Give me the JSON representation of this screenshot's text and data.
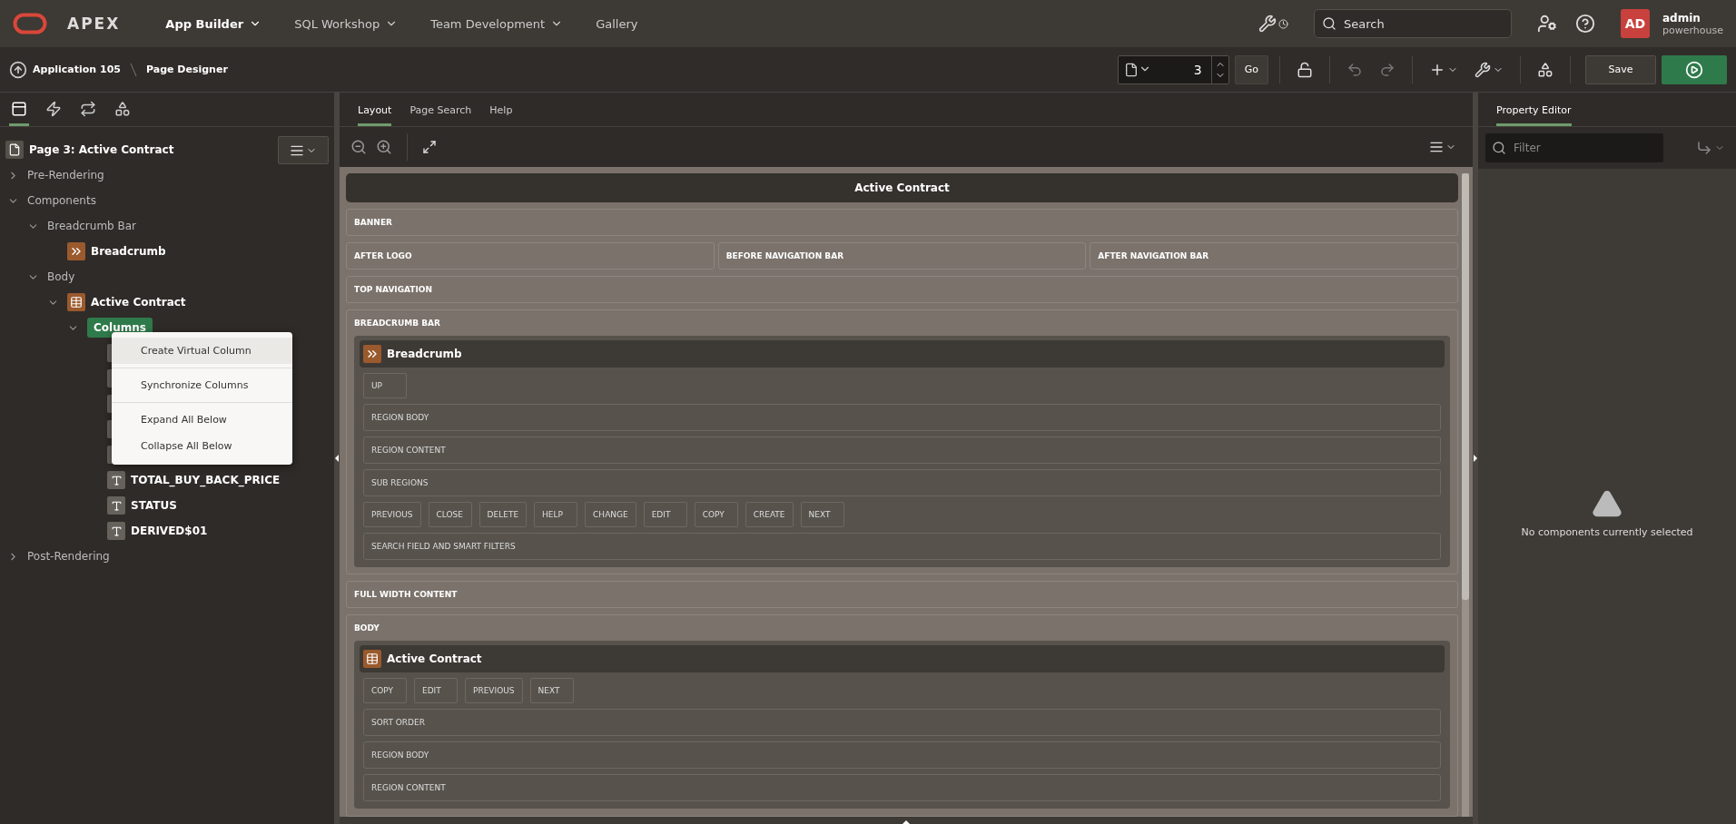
{
  "header": {
    "logo": "APEX",
    "nav": [
      {
        "label": "App Builder",
        "selected": true,
        "dropdown": true
      },
      {
        "label": "SQL Workshop",
        "selected": false,
        "dropdown": true
      },
      {
        "label": "Team Development",
        "selected": false,
        "dropdown": true
      },
      {
        "label": "Gallery",
        "selected": false,
        "dropdown": false
      }
    ],
    "search": {
      "placeholder": "Search"
    },
    "user": {
      "initials": "AD",
      "name": "admin",
      "workspace": "powerhouse"
    }
  },
  "toolbar": {
    "breadcrumb": [
      "Application 105",
      "Page Designer"
    ],
    "page_number": "3",
    "go": "Go",
    "save": "Save"
  },
  "left_panel": {
    "tabs": [
      {
        "kind": "rendering",
        "selected": true
      },
      {
        "kind": "dynamic-actions",
        "selected": false
      },
      {
        "kind": "processing",
        "selected": false
      },
      {
        "kind": "shared",
        "selected": false
      }
    ],
    "tree": [
      {
        "label": "Page 3: Active Contract",
        "kind": "page",
        "selected": false
      },
      {
        "label": "Pre-Rendering",
        "kind": "group",
        "expanded": false,
        "selected": false
      },
      {
        "label": "Components",
        "kind": "group",
        "expanded": true,
        "selected": false,
        "children": [
          {
            "label": "Breadcrumb Bar",
            "kind": "group",
            "expanded": true,
            "selected": false,
            "children": [
              {
                "label": "Breadcrumb",
                "kind": "breadcrumb",
                "selected": false
              }
            ]
          },
          {
            "label": "Body",
            "kind": "group",
            "expanded": true,
            "selected": false,
            "children": [
              {
                "label": "Active Contract",
                "kind": "report",
                "expanded": true,
                "selected": false,
                "children": [
                  {
                    "label": "Columns",
                    "kind": "columns",
                    "expanded": true,
                    "selected": true,
                    "children": [
                      {
                        "kind": "column"
                      },
                      {
                        "kind": "column"
                      },
                      {
                        "kind": "column"
                      },
                      {
                        "kind": "column"
                      },
                      {
                        "kind": "column"
                      },
                      {
                        "label": "TOTAL_BUY_BACK_PRICE",
                        "kind": "column"
                      },
                      {
                        "label": "STATUS",
                        "kind": "column"
                      },
                      {
                        "label": "DERIVED$01",
                        "kind": "column"
                      }
                    ]
                  }
                ]
              }
            ]
          }
        ]
      },
      {
        "label": "Post-Rendering",
        "kind": "group",
        "expanded": false,
        "selected": false
      }
    ]
  },
  "context_menu": {
    "items": [
      {
        "label": "Create Virtual Column",
        "highlighted": true,
        "separator_after": true
      },
      {
        "label": "Synchronize Columns",
        "highlighted": false,
        "separator_after": true
      },
      {
        "label": "Expand All Below",
        "highlighted": false,
        "separator_after": false
      },
      {
        "label": "Collapse All Below",
        "highlighted": false,
        "separator_after": false
      }
    ]
  },
  "layout": {
    "tabs": [
      {
        "label": "Layout",
        "selected": true
      },
      {
        "label": "Page Search",
        "selected": false
      },
      {
        "label": "Help",
        "selected": false
      }
    ],
    "page_title": "Active Contract",
    "slots": [
      {
        "kind": "bar",
        "label": "BANNER"
      },
      {
        "kind": "split",
        "cells": [
          "AFTER LOGO",
          "BEFORE NAVIGATION BAR",
          "AFTER NAVIGATION BAR"
        ]
      },
      {
        "kind": "bar",
        "label": "TOP NAVIGATION"
      },
      {
        "kind": "container",
        "label": "BREADCRUMB BAR",
        "region": {
          "title": "Breadcrumb",
          "kind": "breadcrumb",
          "slots": [
            {
              "kind": "buttons",
              "buttons": [
                "UP"
              ]
            },
            {
              "kind": "bar",
              "label": "REGION BODY"
            },
            {
              "kind": "bar",
              "label": "REGION CONTENT"
            },
            {
              "kind": "bar",
              "label": "SUB REGIONS"
            },
            {
              "kind": "buttons",
              "buttons": [
                "PREVIOUS",
                "CLOSE",
                "DELETE",
                "HELP",
                "CHANGE",
                "EDIT",
                "COPY",
                "CREATE",
                "NEXT"
              ]
            },
            {
              "kind": "bar",
              "label": "SEARCH FIELD AND SMART FILTERS"
            }
          ]
        }
      },
      {
        "kind": "bar",
        "label": "FULL WIDTH CONTENT"
      },
      {
        "kind": "container",
        "label": "BODY",
        "region": {
          "title": "Active Contract",
          "kind": "report",
          "slots": [
            {
              "kind": "buttons",
              "buttons": [
                "COPY",
                "EDIT",
                "PREVIOUS",
                "NEXT"
              ]
            },
            {
              "kind": "bar",
              "label": "SORT ORDER"
            },
            {
              "kind": "bar",
              "label": "REGION BODY"
            },
            {
              "kind": "bar",
              "label": "REGION CONTENT"
            }
          ]
        }
      }
    ]
  },
  "property_editor": {
    "tab": "Property Editor",
    "filter_placeholder": "Filter",
    "message": "No components currently selected"
  }
}
